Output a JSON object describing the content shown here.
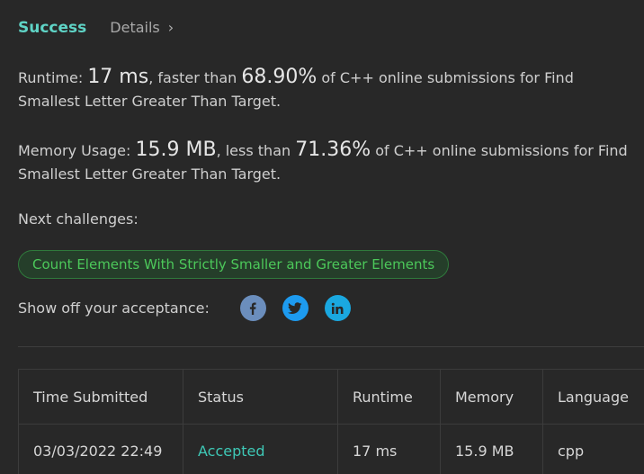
{
  "header": {
    "status": "Success",
    "details_label": "Details",
    "details_chevron": "›"
  },
  "runtime": {
    "label": "Runtime:",
    "value": "17 ms",
    "compare": ", faster than",
    "percent": "68.90%",
    "suffix": "of C++ online submissions for Find Smallest Letter Greater Than Target."
  },
  "memory": {
    "label": "Memory Usage:",
    "value": "15.9 MB",
    "compare": ", less than",
    "percent": "71.36%",
    "suffix": "of C++ online submissions for Find Smallest Letter Greater Than Target."
  },
  "next": {
    "label": "Next challenges:",
    "challenge": "Count Elements With Strictly Smaller and Greater Elements"
  },
  "share": {
    "label": "Show off your acceptance:",
    "icons": [
      "facebook-icon",
      "twitter-icon",
      "linkedin-icon"
    ]
  },
  "table": {
    "headers": [
      "Time Submitted",
      "Status",
      "Runtime",
      "Memory",
      "Language"
    ],
    "rows": [
      [
        "03/03/2022 22:49",
        "Accepted",
        "17 ms",
        "15.9 MB",
        "cpp"
      ]
    ]
  },
  "colors": {
    "background": "#282828",
    "success": "#5fd4c6",
    "accepted": "#3ec8b6",
    "challenge_text": "#4cc85a",
    "facebook": "#6b8ebd",
    "twitter": "#1d9bf0",
    "linkedin": "#1aa8e0"
  }
}
